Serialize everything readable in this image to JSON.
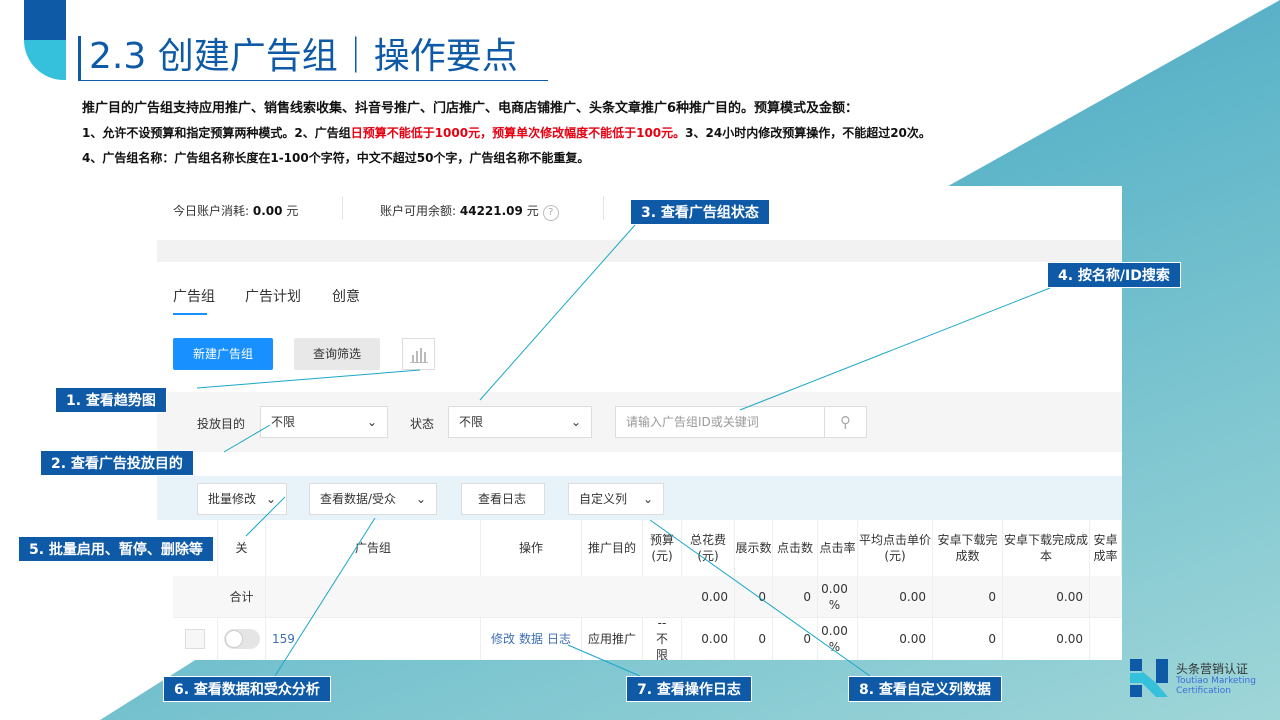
{
  "slide": {
    "title": "2.3 创建广告组｜操作要点",
    "line1": "推广目的广告组支持应用推广、销售线索收集、抖音号推广、门店推广、电商店铺推广、头条文章推广6种推广目的。预算模式及金额：",
    "line2a": "1、允许不设预算和指定预算两种模式。2、广告组",
    "line2b": "日预算不能低于1000元，预算单次修改幅度不能低于100元。",
    "line2c": "3、24小时内修改预算操作，不能超过20次。",
    "line3": "4、广告组名称：广告组名称长度在1-100个字符，中文不超过50个字，广告组名称不能重复。"
  },
  "colors": {
    "brand": "#0e5aa7",
    "accent": "#35c0dc",
    "warning": "#e60012",
    "primary_button": "#1890ff"
  },
  "stats": {
    "spend_label": "今日账户消耗:",
    "spend_value": "0.00",
    "spend_unit": "元",
    "balance_label": "账户可用余额:",
    "balance_value": "44221.09",
    "balance_unit": "元",
    "help": "?"
  },
  "tabs": [
    "广告组",
    "广告计划",
    "创意"
  ],
  "toolbar": {
    "new": "新建广告组",
    "filter": "查询筛选"
  },
  "filters": {
    "purpose_label": "投放目的",
    "purpose_value": "不限",
    "status_label": "状态",
    "status_value": "不限",
    "search_placeholder": "请输入广告组ID或关键词"
  },
  "batch": {
    "edit": "批量修改",
    "data": "查看数据/受众",
    "log": "查看日志",
    "columns": "自定义列"
  },
  "table": {
    "headers": [
      "关",
      "广告组",
      "操作",
      "推广目的",
      "预算(元)",
      "总花费(元)",
      "展示数",
      "点击数",
      "点击率",
      "平均点击单价(元)",
      "安卓下载完成数",
      "安卓下载完成成本",
      "安卓 成率"
    ],
    "total": {
      "label": "合计",
      "values": [
        "0.00",
        "0",
        "0",
        "0.00 %",
        "0.00",
        "0",
        "0.00"
      ]
    },
    "rows": [
      {
        "name": "159",
        "actions": [
          "修改",
          "数据",
          "日志"
        ],
        "purpose": "应用推广",
        "budget": "-- 不限",
        "values": [
          "0.00",
          "0",
          "0",
          "0.00 %",
          "0.00",
          "0",
          "0.00"
        ]
      }
    ]
  },
  "callouts": [
    "1. 查看趋势图",
    "2. 查看广告投放目的",
    "3. 查看广告组状态",
    "4. 按名称/ID搜索",
    "5. 批量启用、暂停、删除等",
    "6. 查看数据和受众分析",
    "7. 查看操作日志",
    "8. 查看自定义列数据"
  ],
  "logo": {
    "cn": "头条营销认证",
    "en1": "Toutiao Marketing",
    "en2": "Certification"
  }
}
